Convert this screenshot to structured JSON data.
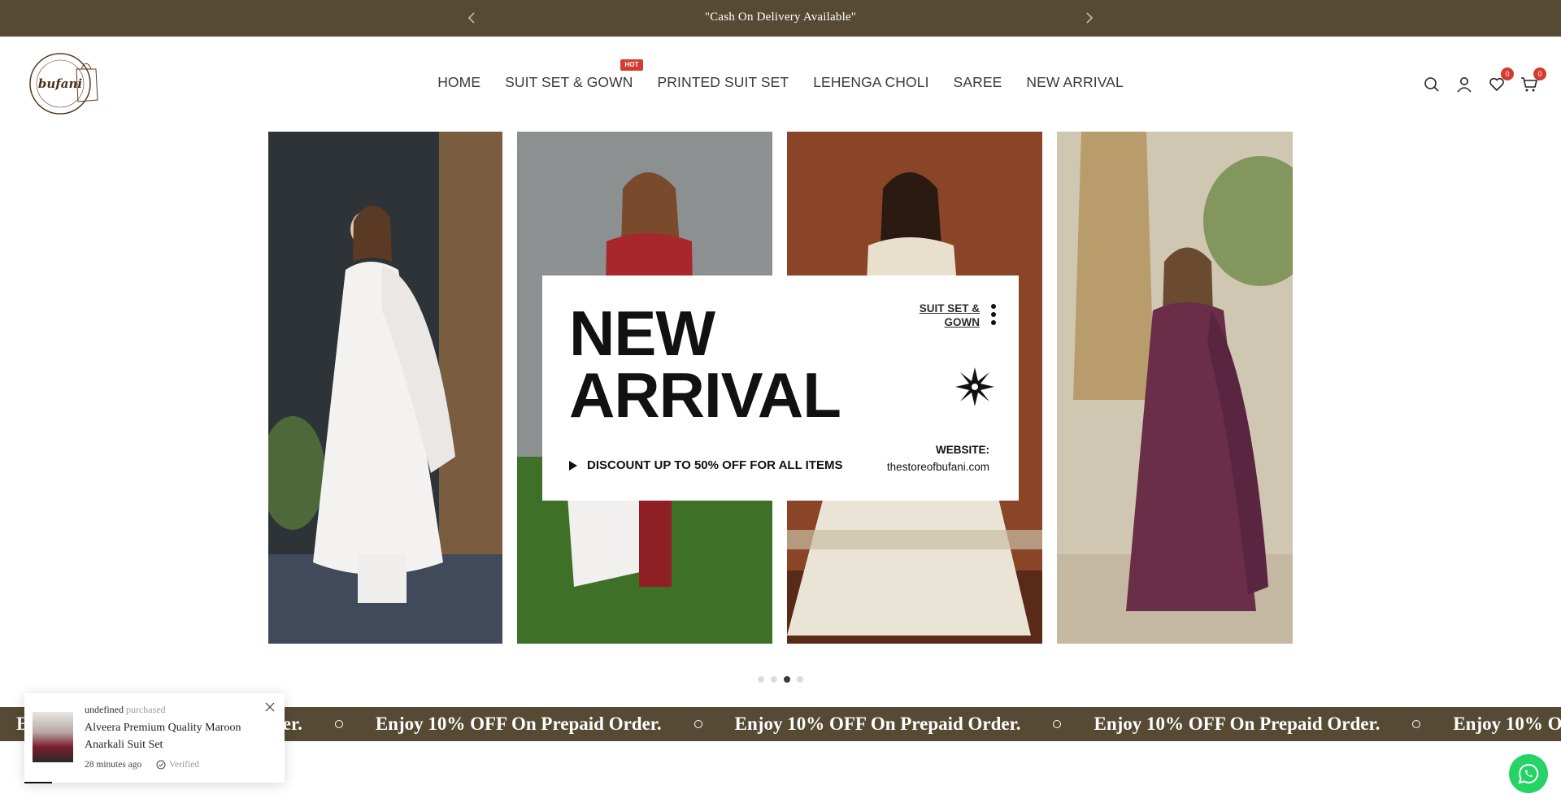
{
  "announcement": {
    "text": "\"Cash On Delivery Available\""
  },
  "logo": {
    "text": "bufani"
  },
  "nav": {
    "items": [
      {
        "label": "HOME"
      },
      {
        "label": "SUIT SET & GOWN",
        "badge": "HOT"
      },
      {
        "label": "PRINTED SUIT SET"
      },
      {
        "label": "LEHENGA CHOLI"
      },
      {
        "label": "SAREE"
      },
      {
        "label": "NEW ARRIVAL"
      }
    ]
  },
  "header_icons": {
    "wishlist_count": "0",
    "cart_count": "0"
  },
  "hero": {
    "title_line1": "NEW",
    "title_line2": "ARRIVAL",
    "category_link": "SUIT SET & GOWN",
    "discount_text": "DISCOUNT UP TO 50% OFF FOR ALL ITEMS",
    "website_label": "WEBSITE:",
    "website_value": "thestoreofbufani.com",
    "slide_count": 4,
    "active_slide": 3
  },
  "marquee": {
    "text": "Enjoy 10% OFF On Prepaid Order."
  },
  "sales_popup": {
    "buyer": "undefined",
    "verb": "purchased",
    "product": "Alveera Premium Quality Maroon Anarkali Suit Set",
    "time": "28 minutes ago",
    "verified": "Verified"
  },
  "colors": {
    "brand": "#574a34",
    "badge": "#d63b2f",
    "whatsapp": "#25d366"
  }
}
